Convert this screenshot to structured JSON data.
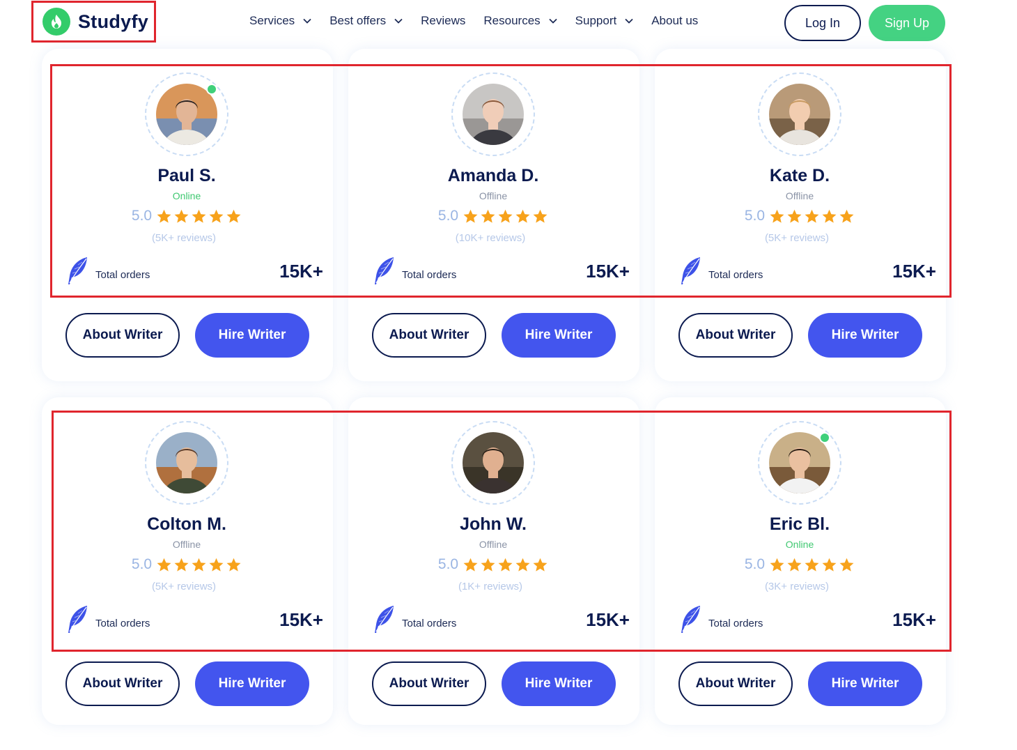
{
  "header": {
    "logo_text": "Studyfy",
    "nav": [
      {
        "label": "Services",
        "dropdown": true
      },
      {
        "label": "Best offers",
        "dropdown": true
      },
      {
        "label": "Reviews",
        "dropdown": false
      },
      {
        "label": "Resources",
        "dropdown": true
      },
      {
        "label": "Support",
        "dropdown": true
      },
      {
        "label": "About us",
        "dropdown": false
      }
    ],
    "login_label": "Log In",
    "signup_label": "Sign Up"
  },
  "writers": [
    {
      "name": "Paul S.",
      "status": "Online",
      "online": true,
      "rating": "5.0",
      "stars": 5,
      "reviews": "(5K+ reviews)",
      "orders_label": "Total orders",
      "orders": "15K+",
      "about_label": "About Writer",
      "hire_label": "Hire Writer"
    },
    {
      "name": "Amanda D.",
      "status": "Offline",
      "online": false,
      "rating": "5.0",
      "stars": 5,
      "reviews": "(10K+ reviews)",
      "orders_label": "Total orders",
      "orders": "15K+",
      "about_label": "About Writer",
      "hire_label": "Hire Writer"
    },
    {
      "name": "Kate D.",
      "status": "Offline",
      "online": false,
      "rating": "5.0",
      "stars": 5,
      "reviews": "(5K+ reviews)",
      "orders_label": "Total orders",
      "orders": "15K+",
      "about_label": "About Writer",
      "hire_label": "Hire Writer"
    },
    {
      "name": "Colton M.",
      "status": "Offline",
      "online": false,
      "rating": "5.0",
      "stars": 5,
      "reviews": "(5K+ reviews)",
      "orders_label": "Total orders",
      "orders": "15K+",
      "about_label": "About Writer",
      "hire_label": "Hire Writer"
    },
    {
      "name": "John W.",
      "status": "Offline",
      "online": false,
      "rating": "5.0",
      "stars": 5,
      "reviews": "(1K+ reviews)",
      "orders_label": "Total orders",
      "orders": "15K+",
      "about_label": "About Writer",
      "hire_label": "Hire Writer"
    },
    {
      "name": "Eric Bl.",
      "status": "Online",
      "online": true,
      "rating": "5.0",
      "stars": 5,
      "reviews": "(3K+ reviews)",
      "orders_label": "Total orders",
      "orders": "15K+",
      "about_label": "About Writer",
      "hire_label": "Hire Writer"
    }
  ],
  "colors": {
    "brand_green": "#44d282",
    "primary_blue": "#4355ee",
    "navy": "#0b1a4f",
    "star": "#f7a21b",
    "highlight": "#e0252d"
  },
  "icons": {
    "logo": "flame-icon",
    "dropdown": "chevron-down-icon",
    "orders": "feather-quill-icon",
    "rating": "star-icon"
  }
}
